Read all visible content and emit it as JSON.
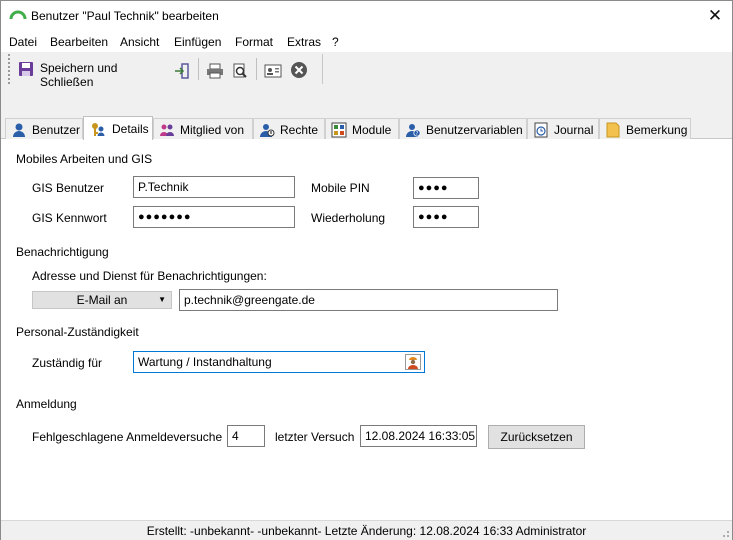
{
  "window": {
    "title": "Benutzer \"Paul Technik\" bearbeiten",
    "close_glyph": "✕"
  },
  "menu": [
    "Datei",
    "Bearbeiten",
    "Ansicht",
    "Einfügen",
    "Format",
    "Extras",
    "?"
  ],
  "toolbar": {
    "save_label": "Speichern und Schließen",
    "icons": [
      "save-icon",
      "exit-icon",
      "print-icon",
      "print-preview-icon",
      "card-icon",
      "cancel-icon"
    ]
  },
  "tabs": [
    {
      "label": "Benutzer",
      "icon": "user-icon"
    },
    {
      "label": "Details",
      "icon": "key-user-icon",
      "active": true
    },
    {
      "label": "Mitglied von",
      "icon": "group-icon"
    },
    {
      "label": "Rechte",
      "icon": "rights-icon"
    },
    {
      "label": "Module",
      "icon": "module-icon"
    },
    {
      "label": "Benutzervariablen",
      "icon": "variables-icon"
    },
    {
      "label": "Journal",
      "icon": "journal-icon"
    },
    {
      "label": "Bemerkung",
      "icon": "note-icon"
    }
  ],
  "mobile": {
    "section": "Mobiles Arbeiten und GIS",
    "gis_user_label": "GIS Benutzer",
    "gis_user_value": "P.Technik",
    "gis_password_label": "GIS Kennwort",
    "gis_password_value": "●●●●●●●",
    "mobile_pin_label": "Mobile PIN",
    "mobile_pin_value": "●●●●",
    "repeat_label": "Wiederholung",
    "repeat_value": "●●●●"
  },
  "notification": {
    "section": "Benachrichtigung",
    "address_label": "Adresse und Dienst für Benachrichtigungen:",
    "service_selected": "E-Mail an",
    "address_value": "p.technik@greengate.de"
  },
  "responsibility": {
    "section": "Personal-Zuständigkeit",
    "label": "Zuständig für",
    "value": "Wartung / Instandhaltung"
  },
  "login": {
    "section": "Anmeldung",
    "failed_label": "Fehlgeschlagene Anmeldeversuche",
    "failed_value": "4",
    "last_attempt_label": "letzter Versuch",
    "last_attempt_value": "12.08.2024 16:33:05",
    "reset_label": "Zurücksetzen"
  },
  "status": {
    "text": "Erstellt: -unbekannt- -unbekannt-  Letzte Änderung: 12.08.2024 16:33 Administrator"
  },
  "colors": {
    "accent_green": "#3fae49",
    "focus_blue": "#0078d7",
    "toolbar_bg": "#f0f0f0"
  }
}
